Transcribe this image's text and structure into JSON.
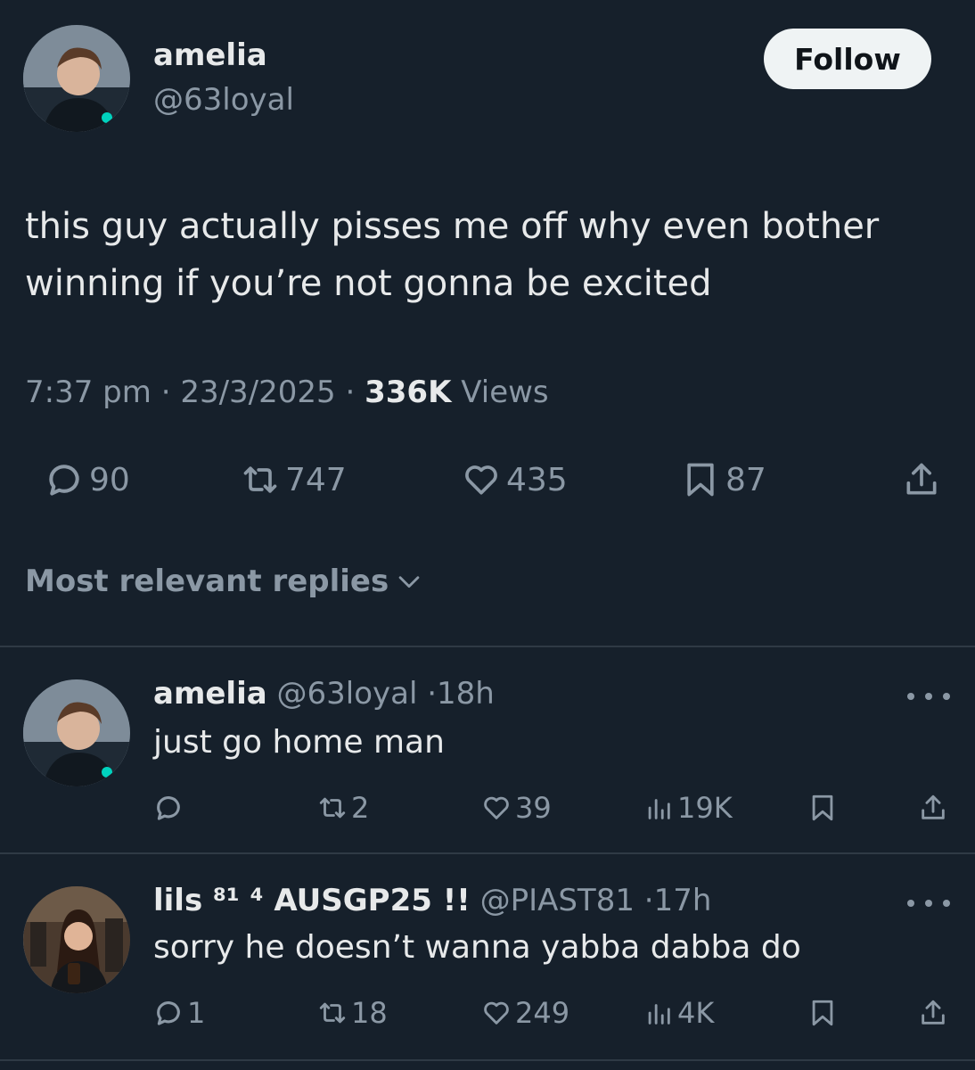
{
  "tweet": {
    "author_name": "amelia",
    "author_handle": "@63loyal",
    "follow_label": "Follow",
    "text": "this guy actually pisses me off why even bother winning if you’re not gonna be excited",
    "time": "7:37 pm",
    "date": "23/3/2025",
    "views_count": "336K",
    "views_label": "Views",
    "stats": {
      "replies": "90",
      "retweets": "747",
      "likes": "435",
      "bookmarks": "87"
    }
  },
  "sort": {
    "label": "Most relevant replies"
  },
  "replies": [
    {
      "name": "amelia",
      "handle": "@63loyal",
      "time": "18h",
      "text": "just go home man",
      "stats": {
        "replies": "",
        "retweets": "2",
        "likes": "39",
        "views": "19K"
      }
    },
    {
      "name": "lils ⁸¹ ⁴ AUSGP25 !!",
      "handle": "@PIAST81",
      "time": "17h",
      "text": "sorry he doesn’t wanna yabba dabba do",
      "stats": {
        "replies": "1",
        "retweets": "18",
        "likes": "249",
        "views": "4K"
      }
    }
  ],
  "icons": {
    "reply": "speech-bubble-icon",
    "retweet": "retweet-icon",
    "like": "heart-icon",
    "bookmark": "bookmark-icon",
    "share": "share-icon",
    "views": "bar-chart-icon",
    "more": "more-dots-icon",
    "chevron": "chevron-down-icon"
  },
  "colors": {
    "background": "#16202b",
    "text_primary": "#e7e9ea",
    "text_secondary": "#8b98a5",
    "follow_button_bg": "#eff3f4",
    "divider": "#2f3a45"
  }
}
